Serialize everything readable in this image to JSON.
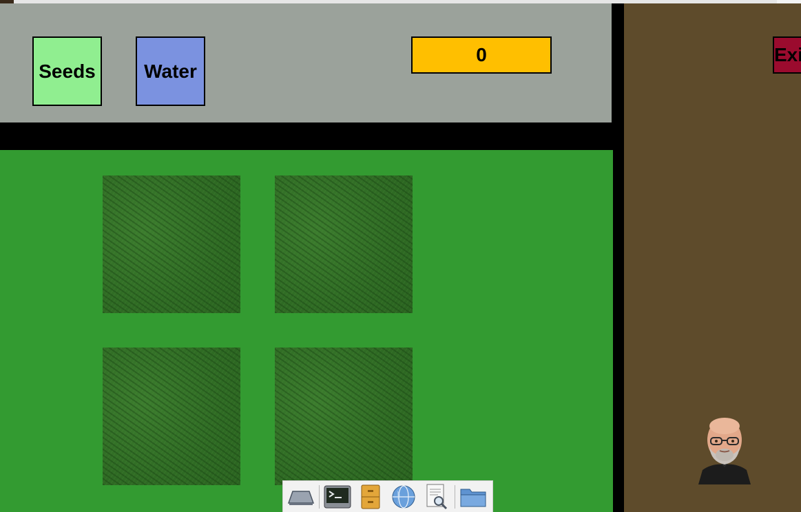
{
  "toolbar": {
    "seeds_label": "Seeds",
    "water_label": "Water",
    "counter_value": "0"
  },
  "side_panel": {
    "exit_label": "Exit"
  },
  "dock": {
    "icons": [
      "desktop-icon",
      "terminal-icon",
      "file-cabinet-icon",
      "web-browser-icon",
      "document-viewer-icon",
      "folder-icon"
    ]
  },
  "colors": {
    "seeds": "#90ee90",
    "water": "#7b92e0",
    "counter": "#ffbf00",
    "exit": "#9b0b2e",
    "field": "#339b31",
    "side_panel": "#5e4b2b",
    "toolbar": "#9ba29b"
  }
}
